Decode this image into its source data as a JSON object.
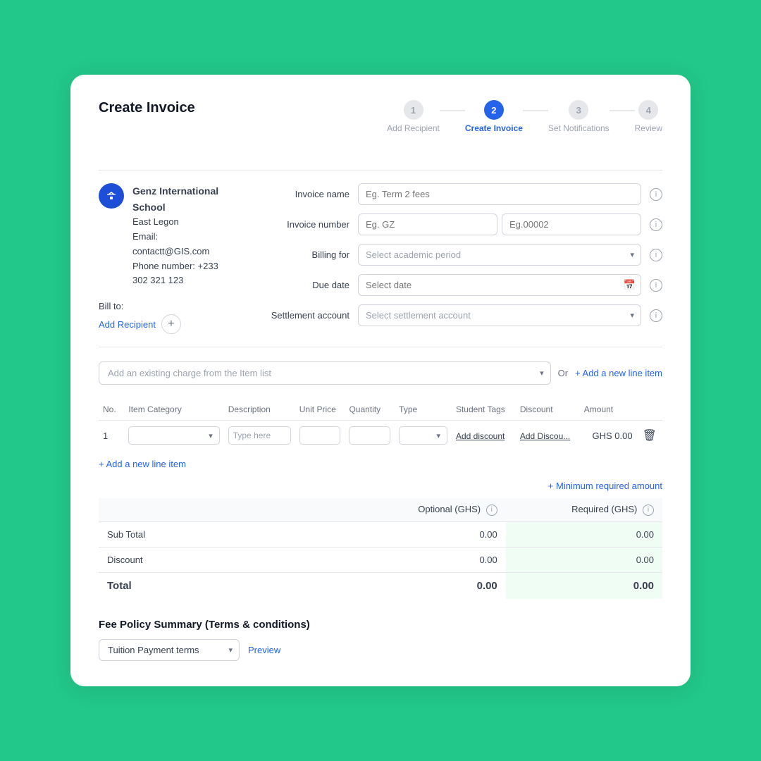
{
  "page": {
    "title": "Create Invoice",
    "background": "#22C78A"
  },
  "stepper": {
    "steps": [
      {
        "number": "1",
        "label": "Add Recipient",
        "active": false
      },
      {
        "number": "2",
        "label": "Create Invoice",
        "active": true
      },
      {
        "number": "3",
        "label": "Set Notifications",
        "active": false
      },
      {
        "number": "4",
        "label": "Review",
        "active": false
      }
    ]
  },
  "school": {
    "avatar_icon": "S",
    "name": "Genz International School",
    "location": "East Legon",
    "email_label": "Email:",
    "email": "contactt@GIS.com",
    "phone_label": "Phone number:",
    "phone": "+233 302 321 123"
  },
  "bill_to": {
    "label": "Bill to:",
    "add_recipient": "Add Recipient"
  },
  "invoice_form": {
    "invoice_name_label": "Invoice name",
    "invoice_name_placeholder": "Eg. Term 2 fees",
    "invoice_number_label": "Invoice number",
    "invoice_number_placeholder1": "Eg. GZ",
    "invoice_number_placeholder2": "Eg.00002",
    "billing_for_label": "Billing for",
    "billing_for_placeholder": "Select academic period",
    "due_date_label": "Due date",
    "due_date_placeholder": "Select date",
    "settlement_account_label": "Settlement account",
    "settlement_account_placeholder": "Select settlement account"
  },
  "line_items": {
    "charge_placeholder": "Add an existing charge from the Item list",
    "or_text": "Or",
    "add_new_line_label": "+ Add a new line item",
    "table_headers": [
      "No.",
      "Item Category",
      "Description",
      "Unit Price",
      "Quantity",
      "Type",
      "Student Tags",
      "Discount",
      "Amount"
    ],
    "rows": [
      {
        "no": "1",
        "category": "",
        "description": "Type here",
        "unit_price": "",
        "quantity": "",
        "type": "",
        "student_tags_label": "Add discount",
        "discount_label": "Add Discou...",
        "amount": "GHS 0.00"
      }
    ],
    "add_item_label": "+ Add a new line item"
  },
  "totals": {
    "min_required_label": "+ Minimum required amount",
    "optional_header": "Optional (GHS)",
    "required_header": "Required (GHS)",
    "subtotal_label": "Sub Total",
    "subtotal_optional": "0.00",
    "subtotal_required": "0.00",
    "discount_label": "Discount",
    "discount_optional": "0.00",
    "discount_required": "0.00",
    "total_label": "Total",
    "total_optional": "0.00",
    "total_required": "0.00"
  },
  "fee_policy": {
    "title": "Fee Policy Summary (Terms & conditions)",
    "select_value": "Tuition Payment terms",
    "preview_label": "Preview"
  }
}
